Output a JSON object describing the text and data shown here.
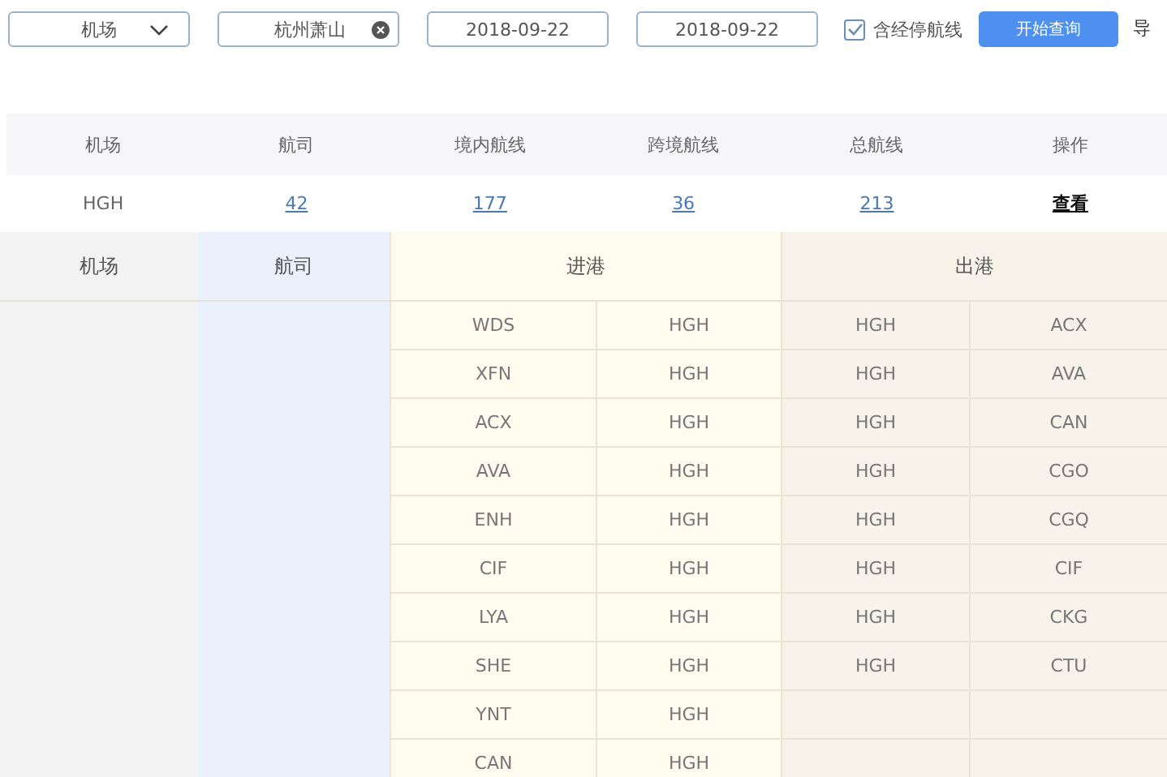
{
  "filters": {
    "type_select": "机场",
    "airport": "杭州萧山",
    "start_date": "2018-09-22",
    "end_date": "2018-09-22",
    "include_stopover": {
      "label": "含经停航线",
      "checked": true
    },
    "search_button": "开始查询",
    "export_link": "导"
  },
  "summary": {
    "columns": [
      "机场",
      "航司",
      "境内航线",
      "跨境航线",
      "总航线",
      "操作"
    ],
    "row": {
      "airport": "HGH",
      "airlines": "42",
      "domestic": "177",
      "cross_border": "36",
      "total": "213",
      "action": "查看"
    }
  },
  "detail": {
    "headers": [
      "机场",
      "航司",
      "进港",
      "出港"
    ],
    "rows": [
      {
        "in_from": "WDS",
        "in_to": "HGH",
        "out_from": "HGH",
        "out_to": "ACX"
      },
      {
        "in_from": "XFN",
        "in_to": "HGH",
        "out_from": "HGH",
        "out_to": "AVA"
      },
      {
        "in_from": "ACX",
        "in_to": "HGH",
        "out_from": "HGH",
        "out_to": "CAN"
      },
      {
        "in_from": "AVA",
        "in_to": "HGH",
        "out_from": "HGH",
        "out_to": "CGO"
      },
      {
        "in_from": "ENH",
        "in_to": "HGH",
        "out_from": "HGH",
        "out_to": "CGQ"
      },
      {
        "in_from": "CIF",
        "in_to": "HGH",
        "out_from": "HGH",
        "out_to": "CIF"
      },
      {
        "in_from": "LYA",
        "in_to": "HGH",
        "out_from": "HGH",
        "out_to": "CKG"
      },
      {
        "in_from": "SHE",
        "in_to": "HGH",
        "out_from": "HGH",
        "out_to": "CTU"
      },
      {
        "in_from": "YNT",
        "in_to": "HGH"
      },
      {
        "in_from": "CAN",
        "in_to": "HGH"
      }
    ]
  }
}
